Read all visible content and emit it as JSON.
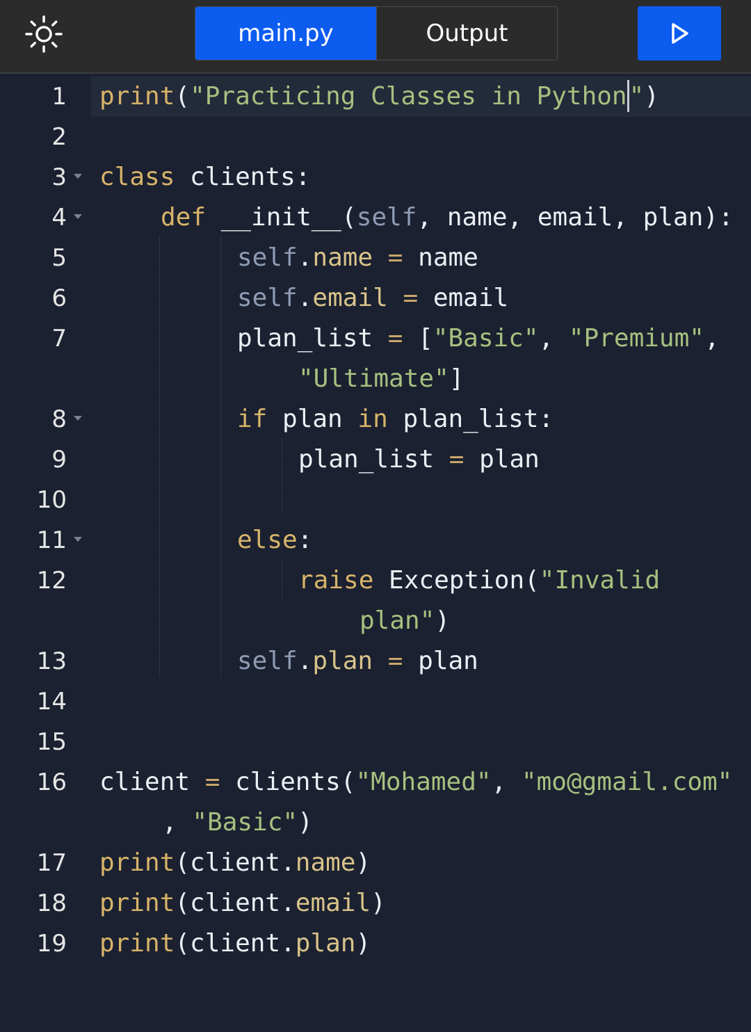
{
  "toolbar": {
    "theme_icon": "sun-icon",
    "tabs": [
      {
        "label": "main.py",
        "active": true
      },
      {
        "label": "Output",
        "active": false
      }
    ],
    "run_icon": "play-icon",
    "accent_color": "#0c5cf0"
  },
  "editor": {
    "current_line": 1,
    "lines": [
      {
        "num": "1",
        "fold": false,
        "segments": [
          [
            "fn",
            "print"
          ],
          [
            "p",
            "("
          ],
          [
            "str",
            "\"Practicing Classes in Python"
          ],
          [
            "cursor",
            ""
          ],
          [
            "str",
            "\""
          ],
          [
            "p",
            ")"
          ]
        ]
      },
      {
        "num": "2",
        "fold": false,
        "segments": []
      },
      {
        "num": "3",
        "fold": true,
        "segments": [
          [
            "kw",
            "class"
          ],
          [
            "p",
            " clients:"
          ]
        ]
      },
      {
        "num": "4",
        "fold": true,
        "segments": [
          [
            "kw",
            "def"
          ],
          [
            "p",
            " __init__("
          ],
          [
            "selfc",
            "self"
          ],
          [
            "p",
            ", name, email, plan):"
          ]
        ]
      },
      {
        "num": "5",
        "fold": false,
        "segments": [
          [
            "selfc",
            "self"
          ],
          [
            "p",
            "."
          ],
          [
            "attr",
            "name"
          ],
          [
            "p",
            " "
          ],
          [
            "op",
            "="
          ],
          [
            "p",
            " name"
          ]
        ]
      },
      {
        "num": "6",
        "fold": false,
        "segments": [
          [
            "selfc",
            "self"
          ],
          [
            "p",
            "."
          ],
          [
            "attr",
            "email"
          ],
          [
            "p",
            " "
          ],
          [
            "op",
            "="
          ],
          [
            "p",
            " email"
          ]
        ]
      },
      {
        "num": "7",
        "fold": false,
        "segments": [
          [
            "p",
            "plan_list "
          ],
          [
            "op",
            "="
          ],
          [
            "p",
            " ["
          ],
          [
            "str",
            "\"Basic\""
          ],
          [
            "p",
            ", "
          ],
          [
            "str",
            "\"Premium\""
          ],
          [
            "p",
            ","
          ]
        ]
      },
      {
        "num": "",
        "fold": false,
        "segments": [
          [
            "str",
            "\"Ultimate\""
          ],
          [
            "p",
            "]"
          ]
        ]
      },
      {
        "num": "8",
        "fold": true,
        "segments": [
          [
            "kw",
            "if"
          ],
          [
            "p",
            " plan "
          ],
          [
            "kw",
            "in"
          ],
          [
            "p",
            " plan_list:"
          ]
        ]
      },
      {
        "num": "9",
        "fold": false,
        "segments": [
          [
            "p",
            "plan_list "
          ],
          [
            "op",
            "="
          ],
          [
            "p",
            " plan"
          ]
        ]
      },
      {
        "num": "10",
        "fold": false,
        "segments": []
      },
      {
        "num": "11",
        "fold": true,
        "segments": [
          [
            "kw",
            "else"
          ],
          [
            "p",
            ":"
          ]
        ]
      },
      {
        "num": "12",
        "fold": false,
        "segments": [
          [
            "kw",
            "raise"
          ],
          [
            "p",
            " Exception("
          ],
          [
            "str",
            "\"Invalid"
          ]
        ]
      },
      {
        "num": "",
        "fold": false,
        "segments": [
          [
            "str",
            "plan\""
          ],
          [
            "p",
            ")"
          ]
        ]
      },
      {
        "num": "13",
        "fold": false,
        "segments": [
          [
            "selfc",
            "self"
          ],
          [
            "p",
            "."
          ],
          [
            "attr",
            "plan"
          ],
          [
            "p",
            " "
          ],
          [
            "op",
            "="
          ],
          [
            "p",
            " plan"
          ]
        ]
      },
      {
        "num": "14",
        "fold": false,
        "segments": []
      },
      {
        "num": "15",
        "fold": false,
        "segments": []
      },
      {
        "num": "16",
        "fold": false,
        "segments": [
          [
            "p",
            "client "
          ],
          [
            "op",
            "="
          ],
          [
            "p",
            " clients("
          ],
          [
            "str",
            "\"Mohamed\""
          ],
          [
            "p",
            ", "
          ],
          [
            "str",
            "\"mo@gmail.com\""
          ]
        ]
      },
      {
        "num": "",
        "fold": false,
        "segments": [
          [
            "p",
            ", "
          ],
          [
            "str",
            "\"Basic\""
          ],
          [
            "p",
            ")"
          ]
        ]
      },
      {
        "num": "17",
        "fold": false,
        "segments": [
          [
            "fn",
            "print"
          ],
          [
            "p",
            "(client."
          ],
          [
            "attr",
            "name"
          ],
          [
            "p",
            ")"
          ]
        ]
      },
      {
        "num": "18",
        "fold": false,
        "segments": [
          [
            "fn",
            "print"
          ],
          [
            "p",
            "(client."
          ],
          [
            "attr",
            "email"
          ],
          [
            "p",
            ")"
          ]
        ]
      },
      {
        "num": "19",
        "fold": false,
        "segments": [
          [
            "fn",
            "print"
          ],
          [
            "p",
            "(client."
          ],
          [
            "attr",
            "plan"
          ],
          [
            "p",
            ")"
          ]
        ]
      }
    ]
  }
}
